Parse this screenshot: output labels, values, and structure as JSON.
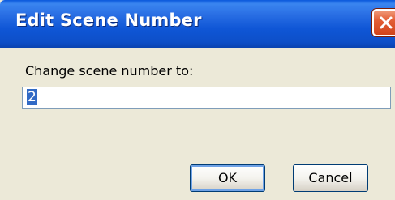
{
  "window": {
    "title": "Edit Scene Number",
    "close_icon": "close-icon"
  },
  "form": {
    "prompt": "Change scene number to:",
    "scene_number_value": "2"
  },
  "buttons": {
    "ok_label": "OK",
    "cancel_label": "Cancel"
  },
  "colors": {
    "titlebar_blue": "#0d4fc8",
    "close_red": "#e35f36",
    "dialog_background": "#ece9d8",
    "selection_blue": "#316ac5"
  }
}
